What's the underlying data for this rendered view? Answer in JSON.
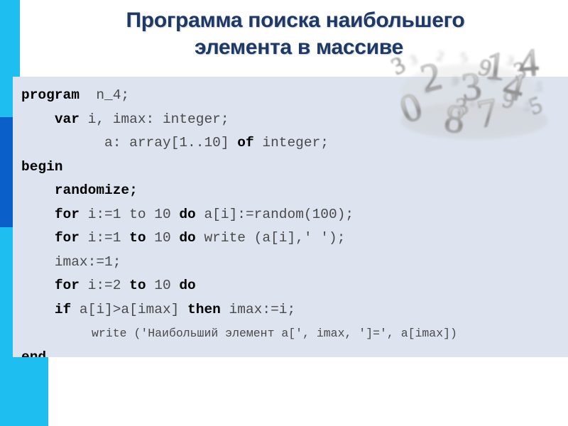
{
  "slide": {
    "title": {
      "line1": "Программа поиска наибольшего",
      "line2": "элемента в массиве"
    },
    "colors": {
      "title_text": "#1f3864",
      "rail_cyan": "#1fbef0",
      "rail_dark_blue": "#0a66d0",
      "code_panel_bg": "#dde4ef",
      "code_text": "#3a3a3a",
      "keyword_text": "#000000",
      "background": "#ffffff"
    },
    "code": {
      "language": "Pascal",
      "lines": [
        {
          "indent": 0,
          "tokens": [
            {
              "t": "program",
              "b": true
            },
            {
              "t": "  n_4;",
              "b": false
            }
          ]
        },
        {
          "indent": 2,
          "tokens": [
            {
              "t": "var",
              "b": true
            },
            {
              "t": " i, imax: integer;",
              "b": false
            }
          ]
        },
        {
          "indent": 5,
          "tokens": [
            {
              "t": "a: array[1..10] ",
              "b": false
            },
            {
              "t": "of",
              "b": true
            },
            {
              "t": " integer;",
              "b": false
            }
          ]
        },
        {
          "indent": 0,
          "tokens": [
            {
              "t": "begin",
              "b": true
            }
          ]
        },
        {
          "indent": 2,
          "tokens": [
            {
              "t": "randomize;",
              "b": true
            }
          ]
        },
        {
          "indent": 2,
          "tokens": [
            {
              "t": "for",
              "b": true
            },
            {
              "t": " i:=1 to 10 ",
              "b": false
            },
            {
              "t": "do",
              "b": true
            },
            {
              "t": " a[i]:=random(100);",
              "b": false
            }
          ]
        },
        {
          "indent": 2,
          "tokens": [
            {
              "t": "for",
              "b": true
            },
            {
              "t": " i:=1 ",
              "b": false
            },
            {
              "t": "to",
              "b": true
            },
            {
              "t": " 10 ",
              "b": false
            },
            {
              "t": "do",
              "b": true
            },
            {
              "t": " write (a[i],' ');",
              "b": false
            }
          ]
        },
        {
          "indent": 2,
          "tokens": [
            {
              "t": "imax:=1;",
              "b": false
            }
          ]
        },
        {
          "indent": 2,
          "tokens": [
            {
              "t": "for",
              "b": true
            },
            {
              "t": " i:=2 ",
              "b": false
            },
            {
              "t": "to",
              "b": true
            },
            {
              "t": " 10 ",
              "b": false
            },
            {
              "t": "do",
              "b": true
            }
          ]
        },
        {
          "indent": 2,
          "tokens": [
            {
              "t": "if",
              "b": true
            },
            {
              "t": " a[i]>a[imax] ",
              "b": false
            },
            {
              "t": "then",
              "b": true
            },
            {
              "t": " imax:=i;",
              "b": false
            }
          ]
        },
        {
          "indent": 5,
          "small": true,
          "tokens": [
            {
              "t": "write ('Наибольший элемент a[', imax, ']=', a[imax])",
              "b": false
            }
          ]
        },
        {
          "indent": 0,
          "tokens": [
            {
              "t": "end.",
              "b": true
            }
          ]
        }
      ]
    },
    "decoration": {
      "name": "scattered-3d-numbers-image",
      "digits": [
        "3",
        "2",
        "9",
        "1",
        "4",
        "0",
        "8",
        "7",
        "3",
        "4",
        "5",
        "6",
        "2",
        "5",
        "3",
        "9"
      ]
    }
  }
}
